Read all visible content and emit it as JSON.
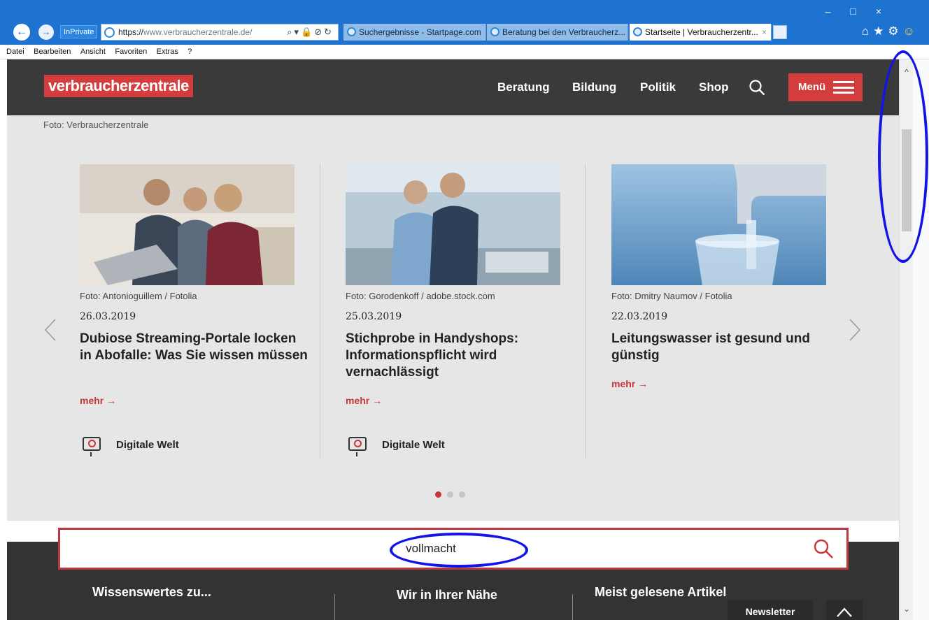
{
  "browser": {
    "inprivate_label": "InPrivate",
    "url_host": "https://www.verbraucherzentrale.de/",
    "url_prefix": "https://",
    "url_rest": "www.verbraucherzentrale.de/",
    "tabs": [
      {
        "title": "Suchergebnisse - Startpage.com"
      },
      {
        "title": "Beratung bei den Verbraucherz..."
      },
      {
        "title": "Startseite | Verbraucherzentr..."
      }
    ],
    "tab_close": "×",
    "window_controls": "–□×",
    "menu": [
      "Datei",
      "Bearbeiten",
      "Ansicht",
      "Favoriten",
      "Extras",
      "?"
    ]
  },
  "site": {
    "logo": "verbraucherzentrale",
    "nav": [
      "Beratung",
      "Bildung",
      "Politik",
      "Shop"
    ],
    "menu_label": "Menü",
    "photo_credit_top": "Foto: Verbraucherzentrale"
  },
  "carousel": {
    "cards": [
      {
        "credit": "Foto: Antonioguillem / Fotolia",
        "date": "26.03.2019",
        "headline": "Dubiose Streaming-Portale locken in Abofalle: Was Sie wissen müssen",
        "more": "mehr →",
        "topic": "Digitale Welt"
      },
      {
        "credit": "Foto: Gorodenkoff / adobe.stock.com",
        "date": "25.03.2019",
        "headline": "Stichprobe in Handyshops: Informationspflicht wird vernachlässigt",
        "more": "mehr →",
        "topic": "Digitale Welt"
      },
      {
        "credit": "Foto: Dmitry Naumov / Fotolia",
        "date": "22.03.2019",
        "headline": "Leitungswasser ist gesund und günstig",
        "more": "mehr →",
        "topic": ""
      }
    ],
    "active_page": 1,
    "page_count": 3
  },
  "search": {
    "value": "vollmacht"
  },
  "footer": {
    "columns": [
      "Wissenswertes zu...",
      "Wir in Ihrer Nähe",
      "Meist gelesene Artikel"
    ],
    "newsletter": "Newsletter"
  },
  "colors": {
    "brand_red": "#d33d3d",
    "header_dark": "#3a3a3a",
    "annotation_blue": "#1414e6",
    "browser_blue": "#1e73d0"
  }
}
